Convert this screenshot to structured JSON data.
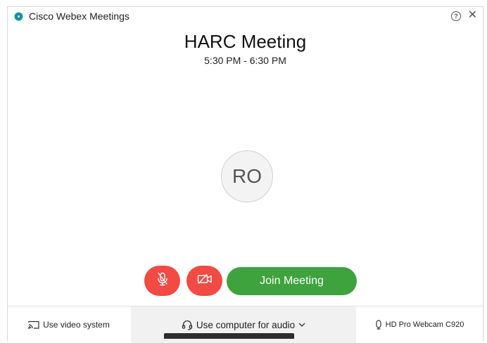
{
  "window": {
    "app_title": "Cisco Webex Meetings",
    "help_symbol": "?",
    "close_symbol": "✕"
  },
  "meeting": {
    "title": "HARC Meeting",
    "time": "5:30 PM - 6:30 PM"
  },
  "avatar": {
    "initials": "RO"
  },
  "controls": {
    "mute_icon": "microphone-muted-icon",
    "video_icon": "camera-off-icon",
    "join_label": "Join Meeting"
  },
  "bottom_bar": {
    "video_system_label": "Use video system",
    "audio_label": "Use computer for audio",
    "camera_label": "HD Pro Webcam C920"
  },
  "colors": {
    "mute_button": "#f14b43",
    "join_button": "#3ea33d",
    "audio_segment_bg": "#f1f1f1"
  }
}
